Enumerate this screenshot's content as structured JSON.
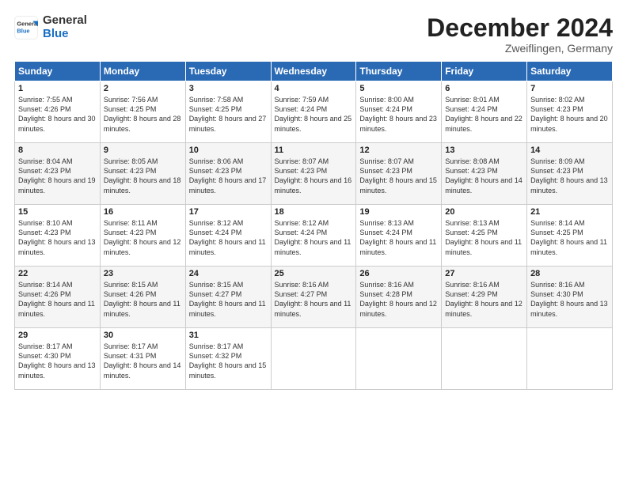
{
  "logo": {
    "general": "General",
    "blue": "Blue"
  },
  "header": {
    "month": "December 2024",
    "location": "Zweiflingen, Germany"
  },
  "days_of_week": [
    "Sunday",
    "Monday",
    "Tuesday",
    "Wednesday",
    "Thursday",
    "Friday",
    "Saturday"
  ],
  "weeks": [
    [
      {
        "day": "1",
        "sunrise": "7:55 AM",
        "sunset": "4:26 PM",
        "daylight": "8 hours and 30 minutes."
      },
      {
        "day": "2",
        "sunrise": "7:56 AM",
        "sunset": "4:25 PM",
        "daylight": "8 hours and 28 minutes."
      },
      {
        "day": "3",
        "sunrise": "7:58 AM",
        "sunset": "4:25 PM",
        "daylight": "8 hours and 27 minutes."
      },
      {
        "day": "4",
        "sunrise": "7:59 AM",
        "sunset": "4:24 PM",
        "daylight": "8 hours and 25 minutes."
      },
      {
        "day": "5",
        "sunrise": "8:00 AM",
        "sunset": "4:24 PM",
        "daylight": "8 hours and 23 minutes."
      },
      {
        "day": "6",
        "sunrise": "8:01 AM",
        "sunset": "4:24 PM",
        "daylight": "8 hours and 22 minutes."
      },
      {
        "day": "7",
        "sunrise": "8:02 AM",
        "sunset": "4:23 PM",
        "daylight": "8 hours and 20 minutes."
      }
    ],
    [
      {
        "day": "8",
        "sunrise": "8:04 AM",
        "sunset": "4:23 PM",
        "daylight": "8 hours and 19 minutes."
      },
      {
        "day": "9",
        "sunrise": "8:05 AM",
        "sunset": "4:23 PM",
        "daylight": "8 hours and 18 minutes."
      },
      {
        "day": "10",
        "sunrise": "8:06 AM",
        "sunset": "4:23 PM",
        "daylight": "8 hours and 17 minutes."
      },
      {
        "day": "11",
        "sunrise": "8:07 AM",
        "sunset": "4:23 PM",
        "daylight": "8 hours and 16 minutes."
      },
      {
        "day": "12",
        "sunrise": "8:07 AM",
        "sunset": "4:23 PM",
        "daylight": "8 hours and 15 minutes."
      },
      {
        "day": "13",
        "sunrise": "8:08 AM",
        "sunset": "4:23 PM",
        "daylight": "8 hours and 14 minutes."
      },
      {
        "day": "14",
        "sunrise": "8:09 AM",
        "sunset": "4:23 PM",
        "daylight": "8 hours and 13 minutes."
      }
    ],
    [
      {
        "day": "15",
        "sunrise": "8:10 AM",
        "sunset": "4:23 PM",
        "daylight": "8 hours and 13 minutes."
      },
      {
        "day": "16",
        "sunrise": "8:11 AM",
        "sunset": "4:23 PM",
        "daylight": "8 hours and 12 minutes."
      },
      {
        "day": "17",
        "sunrise": "8:12 AM",
        "sunset": "4:24 PM",
        "daylight": "8 hours and 11 minutes."
      },
      {
        "day": "18",
        "sunrise": "8:12 AM",
        "sunset": "4:24 PM",
        "daylight": "8 hours and 11 minutes."
      },
      {
        "day": "19",
        "sunrise": "8:13 AM",
        "sunset": "4:24 PM",
        "daylight": "8 hours and 11 minutes."
      },
      {
        "day": "20",
        "sunrise": "8:13 AM",
        "sunset": "4:25 PM",
        "daylight": "8 hours and 11 minutes."
      },
      {
        "day": "21",
        "sunrise": "8:14 AM",
        "sunset": "4:25 PM",
        "daylight": "8 hours and 11 minutes."
      }
    ],
    [
      {
        "day": "22",
        "sunrise": "8:14 AM",
        "sunset": "4:26 PM",
        "daylight": "8 hours and 11 minutes."
      },
      {
        "day": "23",
        "sunrise": "8:15 AM",
        "sunset": "4:26 PM",
        "daylight": "8 hours and 11 minutes."
      },
      {
        "day": "24",
        "sunrise": "8:15 AM",
        "sunset": "4:27 PM",
        "daylight": "8 hours and 11 minutes."
      },
      {
        "day": "25",
        "sunrise": "8:16 AM",
        "sunset": "4:27 PM",
        "daylight": "8 hours and 11 minutes."
      },
      {
        "day": "26",
        "sunrise": "8:16 AM",
        "sunset": "4:28 PM",
        "daylight": "8 hours and 12 minutes."
      },
      {
        "day": "27",
        "sunrise": "8:16 AM",
        "sunset": "4:29 PM",
        "daylight": "8 hours and 12 minutes."
      },
      {
        "day": "28",
        "sunrise": "8:16 AM",
        "sunset": "4:30 PM",
        "daylight": "8 hours and 13 minutes."
      }
    ],
    [
      {
        "day": "29",
        "sunrise": "8:17 AM",
        "sunset": "4:30 PM",
        "daylight": "8 hours and 13 minutes."
      },
      {
        "day": "30",
        "sunrise": "8:17 AM",
        "sunset": "4:31 PM",
        "daylight": "8 hours and 14 minutes."
      },
      {
        "day": "31",
        "sunrise": "8:17 AM",
        "sunset": "4:32 PM",
        "daylight": "8 hours and 15 minutes."
      },
      null,
      null,
      null,
      null
    ]
  ]
}
